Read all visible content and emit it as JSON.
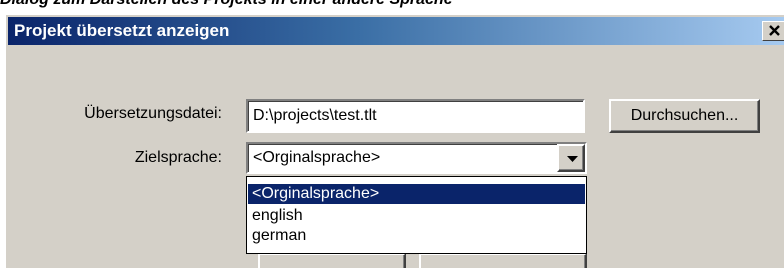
{
  "document": {
    "caption": "Dialog zum Darstellen des Projekts in einer andere Sprache"
  },
  "dialog": {
    "title": "Projekt übersetzt anzeigen",
    "close_glyph": "✕",
    "file_label": "Übersetzungsdatei:",
    "file_value": "D:\\projects\\test.tlt",
    "browse_label": "Durchsuchen...",
    "language_label": "Zielsprache:",
    "language_selected": "<Orginalsprache>",
    "language_options": [
      "<Orginalsprache>",
      "english",
      "german"
    ]
  },
  "colors": {
    "titlebar_start": "#0a246a",
    "titlebar_end": "#a6caf0",
    "dialog_face": "#d4d0c8",
    "selection": "#0a246a"
  },
  "icons": {
    "close": "close-icon",
    "dropdown": "chevron-down-icon"
  }
}
